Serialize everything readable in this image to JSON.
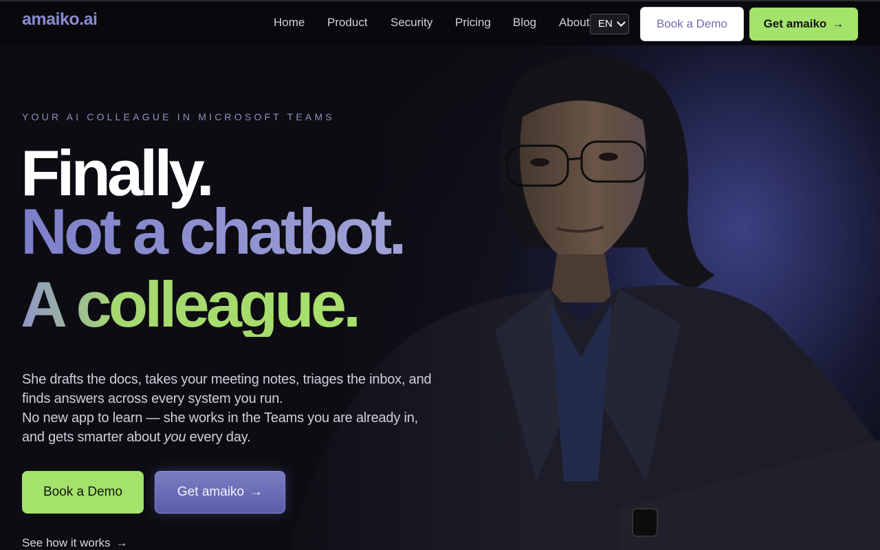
{
  "brand": {
    "logo": "amaiko.ai"
  },
  "nav": {
    "links": [
      "Home",
      "Product",
      "Security",
      "Pricing",
      "Blog",
      "About"
    ],
    "language": "EN",
    "book_demo": "Book a Demo",
    "get_app": "Get amaiko",
    "arrow": "→"
  },
  "hero": {
    "eyebrow": "YOUR AI COLLEAGUE IN MICROSOFT TEAMS",
    "line1": "Finally.",
    "line2": "Not a chatbot.",
    "line3": "A colleague.",
    "lead_1": "She drafts the docs, takes your meeting notes, triages the inbox, and finds answers across every system you run.",
    "lead_2_pre": "No new app to learn — she works in the Teams you are already in, and gets smarter about ",
    "lead_2_em": "you",
    "lead_2_post": " every day.",
    "cta_demo": "Book a Demo",
    "cta_get": "Get amaiko",
    "see_how": "See how it works"
  },
  "colors": {
    "accent_green": "#a3e26b",
    "accent_purple": "#7b7dc4",
    "background": "#0c0c12"
  }
}
